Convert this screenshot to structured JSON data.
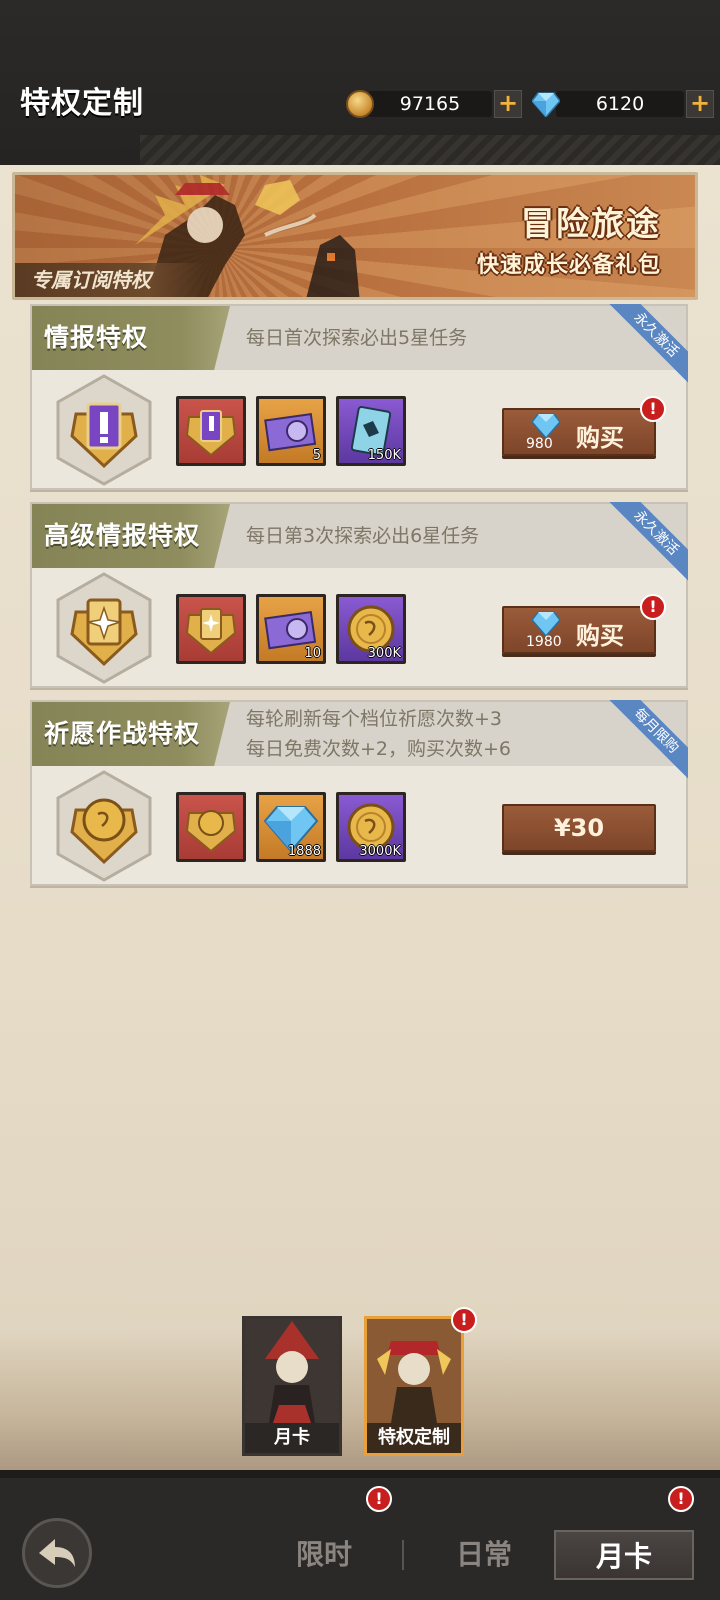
{
  "header": {
    "title": "特权定制",
    "coins": "97165",
    "gems": "6120",
    "plus": "+"
  },
  "banner": {
    "title": "冒险旅途",
    "subtitle": "快速成长必备礼包",
    "tag": "专属订阅特权"
  },
  "cards": [
    {
      "name": "情报特权",
      "desc": "每日首次探索必出5星任务",
      "ribbon": "永久激活",
      "items": [
        {
          "icon": "intel-badge-icon",
          "color": "red",
          "qty": ""
        },
        {
          "icon": "explore-ticket-icon",
          "color": "orange",
          "qty": "5"
        },
        {
          "icon": "card-icon",
          "color": "purple",
          "qty": "150K"
        }
      ],
      "button": {
        "price": "980",
        "label": "购买"
      }
    },
    {
      "name": "高级情报特权",
      "desc": "每日第3次探索必出6星任务",
      "ribbon": "永久激活",
      "items": [
        {
          "icon": "advanced-intel-badge-icon",
          "color": "red",
          "qty": ""
        },
        {
          "icon": "explore-ticket-icon",
          "color": "orange",
          "qty": "10"
        },
        {
          "icon": "gold-coin-icon",
          "color": "purple",
          "qty": "300K"
        }
      ],
      "button": {
        "price": "1980",
        "label": "购买"
      }
    },
    {
      "name": "祈愿作战特权",
      "desc_line1": "每轮刷新每个档位祈愿次数+3",
      "desc_line2": "每日免费次数+2，购买次数+6",
      "ribbon": "每月限购",
      "items": [
        {
          "icon": "wish-badge-icon",
          "color": "red",
          "qty": ""
        },
        {
          "icon": "diamond-icon",
          "color": "orange",
          "qty": "1888"
        },
        {
          "icon": "gold-coin-icon",
          "color": "purple",
          "qty": "3000K"
        }
      ],
      "button": {
        "price_label": "¥30"
      }
    }
  ],
  "portraits": [
    {
      "label": "月卡"
    },
    {
      "label": "特权定制"
    }
  ],
  "alert_mark": "!",
  "nav": {
    "tabs": [
      "限时",
      "日常",
      "月卡"
    ]
  },
  "colors": {
    "accent_gold": "#e8a13a",
    "alert_red": "#c81e1e",
    "ribbon_blue": "#5a86c2",
    "button_brown": "#8a5132"
  }
}
